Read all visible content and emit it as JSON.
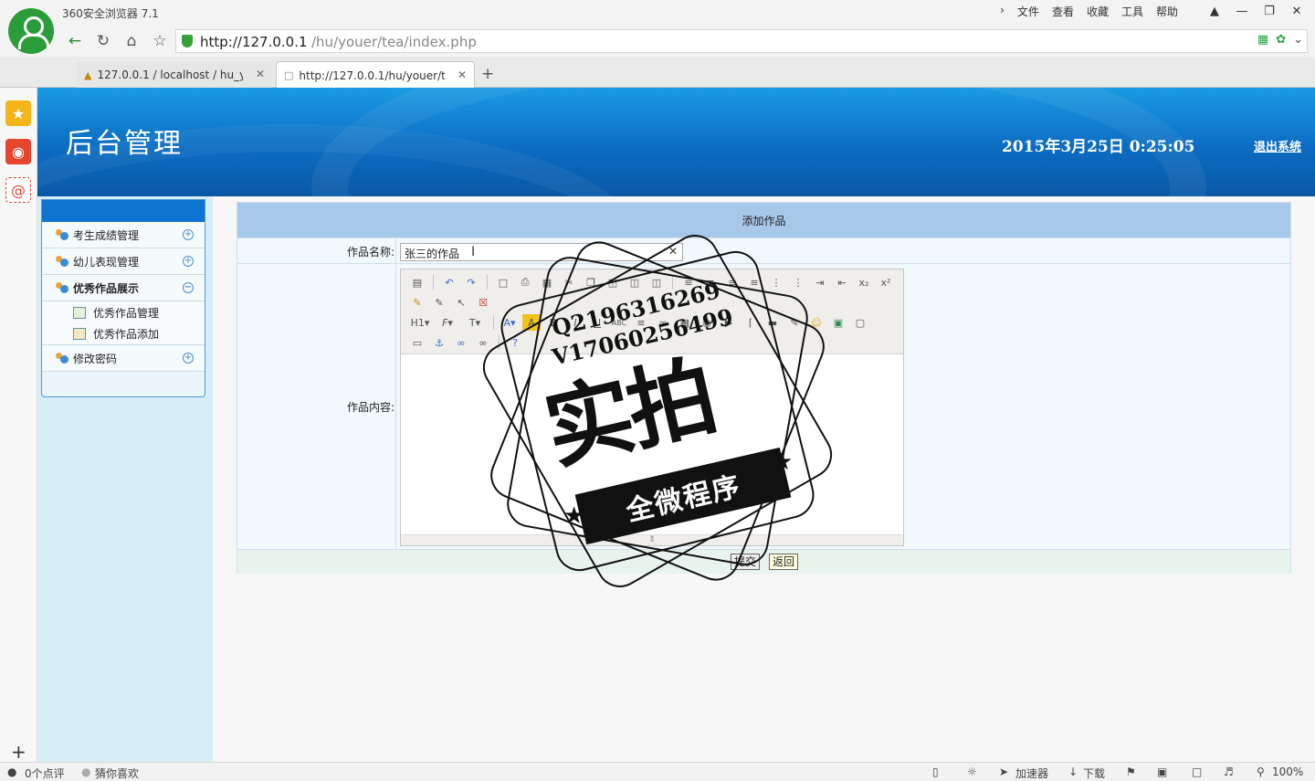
{
  "browser": {
    "app_title": "360安全浏览器 7.1",
    "menu": [
      "文件",
      "查看",
      "收藏",
      "工具",
      "帮助"
    ],
    "url_host": "http://127.0.0.1",
    "url_path": "/hu/youer/tea/index.php",
    "tabs": [
      {
        "label": "127.0.0.1 / localhost / hu_yo",
        "active": false
      },
      {
        "label": "http://127.0.0.1/hu/youer/tea",
        "active": true
      }
    ],
    "status": {
      "comments": "0个点评",
      "guess": "猜你喜欢",
      "accelerator": "加速器",
      "download": "下载",
      "zoom": "100%"
    }
  },
  "banner": {
    "title": "后台管理",
    "datetime": "2015年3月25日  0:25:05",
    "logout": "退出系统"
  },
  "sidebar": {
    "items": [
      {
        "label": "考生成绩管理",
        "expanded": false
      },
      {
        "label": "幼儿表现管理",
        "expanded": false
      },
      {
        "label": "优秀作品展示",
        "expanded": true,
        "children": [
          "优秀作品管理",
          "优秀作品添加"
        ]
      },
      {
        "label": "修改密码",
        "expanded": false
      }
    ]
  },
  "form": {
    "heading": "添加作品",
    "name_label": "作品名称:",
    "name_value": "张三的作品",
    "content_label": "作品内容:",
    "submit": "提交",
    "back": "返回",
    "toolbar_labels": {
      "heading": "H1",
      "font": "F",
      "size": "T",
      "abc": "ABC"
    }
  },
  "watermark": {
    "qq": "Q2196316269",
    "vx": "V17060256499",
    "big": "实拍",
    "ribbon": "全微程序"
  }
}
